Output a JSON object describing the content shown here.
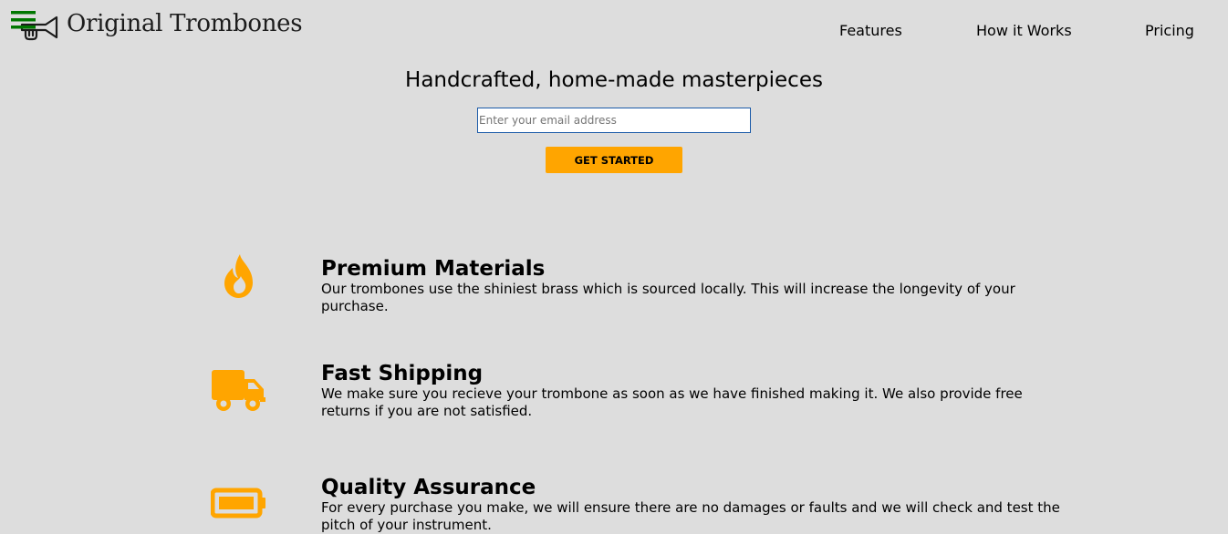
{
  "header": {
    "brand": "Original Trombones",
    "nav": [
      "Features",
      "How it Works",
      "Pricing"
    ]
  },
  "hero": {
    "title": "Handcrafted, home-made masterpieces",
    "email_placeholder": "Enter your email address",
    "button_label": "GET STARTED"
  },
  "features": [
    {
      "icon": "fire-icon",
      "title": "Premium Materials",
      "description": "Our trombones use the shiniest brass which is sourced locally. This will increase the longevity of your purchase."
    },
    {
      "icon": "truck-icon",
      "title": "Fast Shipping",
      "description": "We make sure you recieve your trombone as soon as we have finished making it. We also provide free returns if you are not satisfied."
    },
    {
      "icon": "battery-icon",
      "title": "Quality Assurance",
      "description": "For every purchase you make, we will ensure there are no damages or faults and we will check and test the pitch of your instrument."
    }
  ],
  "colors": {
    "background": "#dddddd",
    "accent": "#ffa500",
    "menu_icon": "#007700",
    "input_border": "#1a5aa8"
  }
}
